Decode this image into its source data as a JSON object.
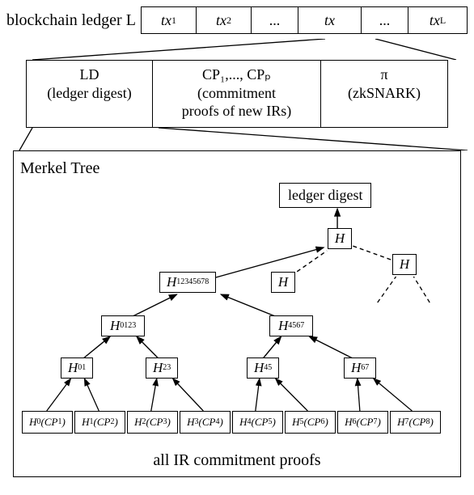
{
  "row1": {
    "label": "blockchain ledger L",
    "cells": [
      "tx",
      "tx",
      "...",
      "tx",
      "...",
      "tx"
    ],
    "subs": [
      "1",
      "2",
      "",
      "",
      "",
      "L"
    ]
  },
  "row2": {
    "a_top": "LD",
    "a_bot": "(ledger digest)",
    "b_top": "CP₁,..., CPₚ",
    "b_mid": "(commitment",
    "b_bot": "proofs of new IRs)",
    "c_top": "π",
    "c_bot": "(zkSNARK)"
  },
  "mt": {
    "title": "Merkel Tree",
    "digest": "ledger digest",
    "root2": "H",
    "hleft": "H",
    "hright": "H",
    "h12345678": "H",
    "h12345678_sub": "12345678",
    "h0123": "H",
    "h0123_sub": "0123",
    "h4567": "H",
    "h4567_sub": "4567",
    "h01": "H",
    "h01_sub": "01",
    "h23": "H",
    "h23_sub": "23",
    "h45": "H",
    "h45_sub": "45",
    "h67": "H",
    "h67_sub": "67",
    "leaves": [
      {
        "h": "H",
        "hs": "0",
        "cp": "CP",
        "cps": "1"
      },
      {
        "h": "H",
        "hs": "1",
        "cp": "CP",
        "cps": "2"
      },
      {
        "h": "H",
        "hs": "2",
        "cp": "CP",
        "cps": "3"
      },
      {
        "h": "H",
        "hs": "3",
        "cp": "CP",
        "cps": "4"
      },
      {
        "h": "H",
        "hs": "4",
        "cp": "CP",
        "cps": "5"
      },
      {
        "h": "H",
        "hs": "5",
        "cp": "CP",
        "cps": "6"
      },
      {
        "h": "H",
        "hs": "6",
        "cp": "CP",
        "cps": "7"
      },
      {
        "h": "H",
        "hs": "7",
        "cp": "CP",
        "cps": "8"
      }
    ],
    "caption": "all IR commitment proofs"
  }
}
